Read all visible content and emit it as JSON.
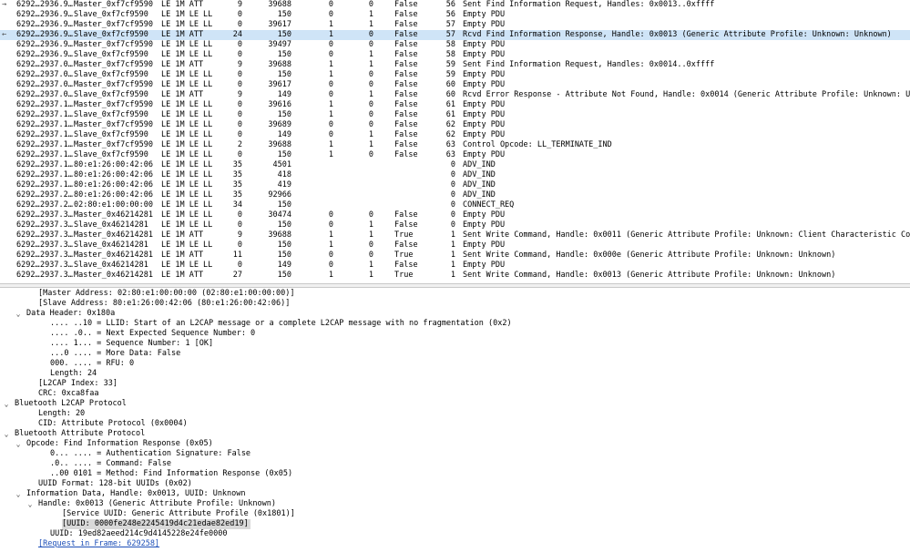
{
  "packets": [
    {
      "no": "6292…",
      "time": "2936.9…",
      "src": "Master_0xf7cf9590",
      "proto": "LE 1M ATT",
      "len": "9",
      "aa": "39688",
      "sn": "0",
      "nesn": "0",
      "md": "False",
      "info_num": "56",
      "info": "Sent Find Information Request, Handles: 0x0013..0xffff",
      "arrow": "→"
    },
    {
      "no": "6292…",
      "time": "2936.9…",
      "src": "Slave_0xf7cf9590",
      "proto": "LE 1M LE LL",
      "len": "0",
      "aa": "150",
      "sn": "0",
      "nesn": "1",
      "md": "False",
      "info_num": "56",
      "info": "Empty PDU",
      "arrow": ""
    },
    {
      "no": "6292…",
      "time": "2936.9…",
      "src": "Master_0xf7cf9590",
      "proto": "LE 1M LE LL",
      "len": "0",
      "aa": "39617",
      "sn": "1",
      "nesn": "1",
      "md": "False",
      "info_num": "57",
      "info": "Empty PDU",
      "arrow": ""
    },
    {
      "no": "6292…",
      "time": "2936.9…",
      "src": "Slave_0xf7cf9590",
      "proto": "LE 1M ATT",
      "len": "24",
      "aa": "150",
      "sn": "1",
      "nesn": "0",
      "md": "False",
      "info_num": "57",
      "info": "Rcvd Find Information Response, Handle: 0x0013 (Generic Attribute Profile: Unknown: Unknown)",
      "arrow": "←",
      "selected": true
    },
    {
      "no": "6292…",
      "time": "2936.9…",
      "src": "Master_0xf7cf9590",
      "proto": "LE 1M LE LL",
      "len": "0",
      "aa": "39497",
      "sn": "0",
      "nesn": "0",
      "md": "False",
      "info_num": "58",
      "info": "Empty PDU",
      "arrow": ""
    },
    {
      "no": "6292…",
      "time": "2936.9…",
      "src": "Slave_0xf7cf9590",
      "proto": "LE 1M LE LL",
      "len": "0",
      "aa": "150",
      "sn": "0",
      "nesn": "1",
      "md": "False",
      "info_num": "58",
      "info": "Empty PDU",
      "arrow": ""
    },
    {
      "no": "6292…",
      "time": "2937.0…",
      "src": "Master_0xf7cf9590",
      "proto": "LE 1M ATT",
      "len": "9",
      "aa": "39688",
      "sn": "1",
      "nesn": "1",
      "md": "False",
      "info_num": "59",
      "info": "Sent Find Information Request, Handles: 0x0014..0xffff",
      "arrow": ""
    },
    {
      "no": "6292…",
      "time": "2937.0…",
      "src": "Slave_0xf7cf9590",
      "proto": "LE 1M LE LL",
      "len": "0",
      "aa": "150",
      "sn": "1",
      "nesn": "0",
      "md": "False",
      "info_num": "59",
      "info": "Empty PDU",
      "arrow": ""
    },
    {
      "no": "6292…",
      "time": "2937.0…",
      "src": "Master_0xf7cf9590",
      "proto": "LE 1M LE LL",
      "len": "0",
      "aa": "39617",
      "sn": "0",
      "nesn": "0",
      "md": "False",
      "info_num": "60",
      "info": "Empty PDU",
      "arrow": ""
    },
    {
      "no": "6292…",
      "time": "2937.0…",
      "src": "Slave_0xf7cf9590",
      "proto": "LE 1M ATT",
      "len": "9",
      "aa": "149",
      "sn": "0",
      "nesn": "1",
      "md": "False",
      "info_num": "60",
      "info": "Rcvd Error Response - Attribute Not Found, Handle: 0x0014 (Generic Attribute Profile: Unknown: Unknown)",
      "arrow": ""
    },
    {
      "no": "6292…",
      "time": "2937.1…",
      "src": "Master_0xf7cf9590",
      "proto": "LE 1M LE LL",
      "len": "0",
      "aa": "39616",
      "sn": "1",
      "nesn": "0",
      "md": "False",
      "info_num": "61",
      "info": "Empty PDU",
      "arrow": ""
    },
    {
      "no": "6292…",
      "time": "2937.1…",
      "src": "Slave_0xf7cf9590",
      "proto": "LE 1M LE LL",
      "len": "0",
      "aa": "150",
      "sn": "1",
      "nesn": "0",
      "md": "False",
      "info_num": "61",
      "info": "Empty PDU",
      "arrow": ""
    },
    {
      "no": "6292…",
      "time": "2937.1…",
      "src": "Master_0xf7cf9590",
      "proto": "LE 1M LE LL",
      "len": "0",
      "aa": "39689",
      "sn": "0",
      "nesn": "0",
      "md": "False",
      "info_num": "62",
      "info": "Empty PDU",
      "arrow": ""
    },
    {
      "no": "6292…",
      "time": "2937.1…",
      "src": "Slave_0xf7cf9590",
      "proto": "LE 1M LE LL",
      "len": "0",
      "aa": "149",
      "sn": "0",
      "nesn": "1",
      "md": "False",
      "info_num": "62",
      "info": "Empty PDU",
      "arrow": ""
    },
    {
      "no": "6292…",
      "time": "2937.1…",
      "src": "Master_0xf7cf9590",
      "proto": "LE 1M LE LL",
      "len": "2",
      "aa": "39688",
      "sn": "1",
      "nesn": "1",
      "md": "False",
      "info_num": "63",
      "info": "Control Opcode: LL_TERMINATE_IND",
      "arrow": ""
    },
    {
      "no": "6292…",
      "time": "2937.1…",
      "src": "Slave_0xf7cf9590",
      "proto": "LE 1M LE LL",
      "len": "0",
      "aa": "150",
      "sn": "1",
      "nesn": "0",
      "md": "False",
      "info_num": "63",
      "info": "Empty PDU",
      "arrow": ""
    },
    {
      "no": "6292…",
      "time": "2937.1…",
      "src": "80:e1:26:00:42:06",
      "proto": "LE 1M LE LL",
      "len": "35",
      "aa": "4501",
      "sn": "",
      "nesn": "",
      "md": "",
      "info_num": "0",
      "info": "ADV_IND",
      "arrow": ""
    },
    {
      "no": "6292…",
      "time": "2937.1…",
      "src": "80:e1:26:00:42:06",
      "proto": "LE 1M LE LL",
      "len": "35",
      "aa": "418",
      "sn": "",
      "nesn": "",
      "md": "",
      "info_num": "0",
      "info": "ADV_IND",
      "arrow": ""
    },
    {
      "no": "6292…",
      "time": "2937.1…",
      "src": "80:e1:26:00:42:06",
      "proto": "LE 1M LE LL",
      "len": "35",
      "aa": "419",
      "sn": "",
      "nesn": "",
      "md": "",
      "info_num": "0",
      "info": "ADV_IND",
      "arrow": ""
    },
    {
      "no": "6292…",
      "time": "2937.2…",
      "src": "80:e1:26:00:42:06",
      "proto": "LE 1M LE LL",
      "len": "35",
      "aa": "92966",
      "sn": "",
      "nesn": "",
      "md": "",
      "info_num": "0",
      "info": "ADV_IND",
      "arrow": ""
    },
    {
      "no": "6292…",
      "time": "2937.2…",
      "src": "02:80:e1:00:00:00",
      "proto": "LE 1M LE LL",
      "len": "34",
      "aa": "150",
      "sn": "",
      "nesn": "",
      "md": "",
      "info_num": "0",
      "info": "CONNECT_REQ",
      "arrow": ""
    },
    {
      "no": "6292…",
      "time": "2937.3…",
      "src": "Master_0x46214281",
      "proto": "LE 1M LE LL",
      "len": "0",
      "aa": "30474",
      "sn": "0",
      "nesn": "0",
      "md": "False",
      "info_num": "0",
      "info": "Empty PDU",
      "arrow": ""
    },
    {
      "no": "6292…",
      "time": "2937.3…",
      "src": "Slave_0x46214281",
      "proto": "LE 1M LE LL",
      "len": "0",
      "aa": "150",
      "sn": "0",
      "nesn": "1",
      "md": "False",
      "info_num": "0",
      "info": "Empty PDU",
      "arrow": ""
    },
    {
      "no": "6292…",
      "time": "2937.3…",
      "src": "Master_0x46214281",
      "proto": "LE 1M ATT",
      "len": "9",
      "aa": "39688",
      "sn": "1",
      "nesn": "1",
      "md": "True",
      "info_num": "1",
      "info": "Sent Write Command, Handle: 0x0011 (Generic Attribute Profile: Unknown: Client Characteristic Configuration)",
      "arrow": ""
    },
    {
      "no": "6292…",
      "time": "2937.3…",
      "src": "Slave_0x46214281",
      "proto": "LE 1M LE LL",
      "len": "0",
      "aa": "150",
      "sn": "1",
      "nesn": "0",
      "md": "False",
      "info_num": "1",
      "info": "Empty PDU",
      "arrow": ""
    },
    {
      "no": "6292…",
      "time": "2937.3…",
      "src": "Master_0x46214281",
      "proto": "LE 1M ATT",
      "len": "11",
      "aa": "150",
      "sn": "0",
      "nesn": "0",
      "md": "True",
      "info_num": "1",
      "info": "Sent Write Command, Handle: 0x000e (Generic Attribute Profile: Unknown: Unknown)",
      "arrow": ""
    },
    {
      "no": "6292…",
      "time": "2937.3…",
      "src": "Slave_0x46214281",
      "proto": "LE 1M LE LL",
      "len": "0",
      "aa": "149",
      "sn": "0",
      "nesn": "1",
      "md": "False",
      "info_num": "1",
      "info": "Empty PDU",
      "arrow": ""
    },
    {
      "no": "6292…",
      "time": "2937.3…",
      "src": "Master_0x46214281",
      "proto": "LE 1M ATT",
      "len": "27",
      "aa": "150",
      "sn": "1",
      "nesn": "1",
      "md": "True",
      "info_num": "1",
      "info": "Sent Write Command, Handle: 0x0013 (Generic Attribute Profile: Unknown: Unknown)",
      "arrow": ""
    }
  ],
  "details": [
    {
      "text": "[Master Address: 02:80:e1:00:00:00 (02:80:e1:00:00:00)]",
      "level": 2,
      "toggle": ""
    },
    {
      "text": "[Slave Address: 80:e1:26:00:42:06 (80:e1:26:00:42:06)]",
      "level": 2,
      "toggle": ""
    },
    {
      "text": "Data Header: 0x180a",
      "level": 1,
      "toggle": "v"
    },
    {
      "text": ".... ..10 = LLID: Start of an L2CAP message or a complete L2CAP message with no fragmentation (0x2)",
      "level": 3,
      "toggle": ""
    },
    {
      "text": ".... .0.. = Next Expected Sequence Number: 0",
      "level": 3,
      "toggle": ""
    },
    {
      "text": ".... 1... = Sequence Number: 1 [OK]",
      "level": 3,
      "toggle": ""
    },
    {
      "text": "...0 .... = More Data: False",
      "level": 3,
      "toggle": ""
    },
    {
      "text": "000. .... = RFU: 0",
      "level": 3,
      "toggle": ""
    },
    {
      "text": "Length: 24",
      "level": 3,
      "toggle": ""
    },
    {
      "text": "[L2CAP Index: 33]",
      "level": 2,
      "toggle": ""
    },
    {
      "text": "CRC: 0xca8faa",
      "level": 2,
      "toggle": ""
    },
    {
      "text": "Bluetooth L2CAP Protocol",
      "level": 0,
      "toggle": "v"
    },
    {
      "text": "Length: 20",
      "level": 2,
      "toggle": ""
    },
    {
      "text": "CID: Attribute Protocol (0x0004)",
      "level": 2,
      "toggle": ""
    },
    {
      "text": "Bluetooth Attribute Protocol",
      "level": 0,
      "toggle": "v"
    },
    {
      "text": "Opcode: Find Information Response (0x05)",
      "level": 1,
      "toggle": "v"
    },
    {
      "text": "0... .... = Authentication Signature: False",
      "level": 3,
      "toggle": ""
    },
    {
      "text": ".0.. .... = Command: False",
      "level": 3,
      "toggle": ""
    },
    {
      "text": "..00 0101 = Method: Find Information Response (0x05)",
      "level": 3,
      "toggle": ""
    },
    {
      "text": "UUID Format: 128-bit UUIDs (0x02)",
      "level": 2,
      "toggle": ""
    },
    {
      "text": "Information Data, Handle: 0x0013, UUID: Unknown",
      "level": 1,
      "toggle": "v"
    },
    {
      "text": "Handle: 0x0013 (Generic Attribute Profile: Unknown)",
      "level": 2,
      "toggle": "v"
    },
    {
      "text": "[Service UUID: Generic Attribute Profile (0x1801)]",
      "level": 4,
      "toggle": ""
    },
    {
      "text": "[UUID: 0000fe248e2245419d4c21edae82ed19]",
      "level": 4,
      "toggle": "",
      "highlight": true
    },
    {
      "text": "UUID: 19ed82aeed214c9d4145228e24fe0000",
      "level": 3,
      "toggle": ""
    },
    {
      "text": "[Request in Frame: 629258]",
      "level": 2,
      "toggle": "",
      "link": true
    }
  ]
}
